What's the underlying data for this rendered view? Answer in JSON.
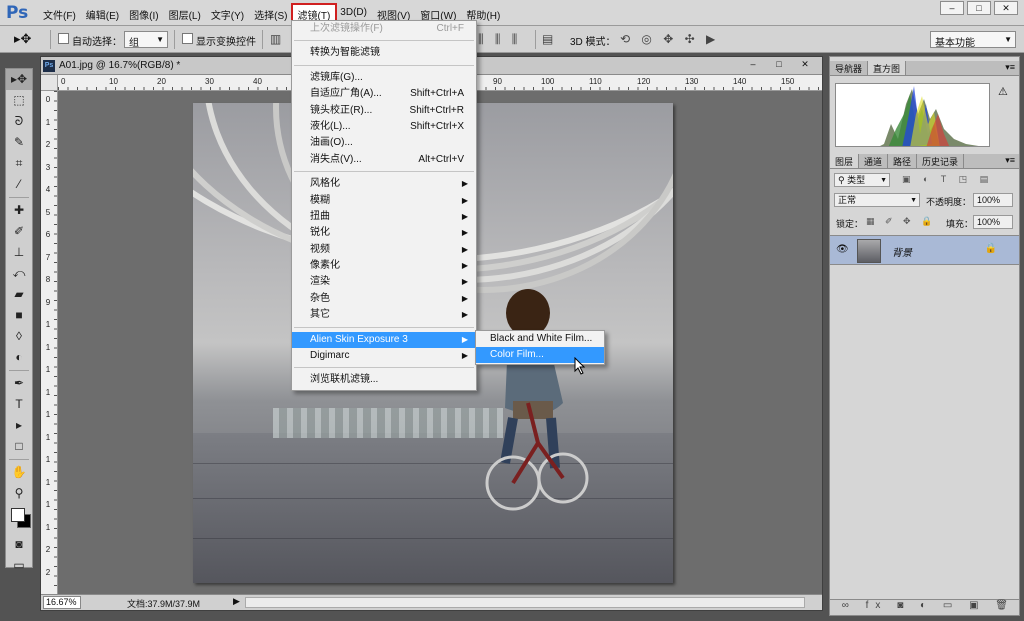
{
  "app": {
    "logo": "Ps"
  },
  "menubar": {
    "items": [
      "文件(F)",
      "编辑(E)",
      "图像(I)",
      "图层(L)",
      "文字(Y)",
      "选择(S)",
      "滤镜(T)",
      "3D(D)",
      "视图(V)",
      "窗口(W)",
      "帮助(H)"
    ],
    "active_index": 6
  },
  "window_controls": {
    "minimize": "–",
    "maximize": "□",
    "close": "✕"
  },
  "options": {
    "auto_select_label": "自动选择：",
    "auto_select_value": "组",
    "show_transform_label": "显示变换控件",
    "mode3d_label": "3D 模式：",
    "workspace": "基本功能"
  },
  "document": {
    "title": "A01.jpg @ 16.7%(RGB/8) *",
    "ruler_h": [
      "0",
      "10",
      "20",
      "30",
      "40",
      "50",
      "60",
      "70",
      "80",
      "90",
      "100",
      "110",
      "120",
      "130",
      "140",
      "150"
    ],
    "ruler_v": [
      "0",
      "1",
      "2",
      "3",
      "4",
      "5",
      "6",
      "7",
      "8",
      "9",
      "1",
      "1",
      "1",
      "1",
      "1",
      "1",
      "1",
      "1",
      "1",
      "1",
      "2",
      "2"
    ],
    "zoom": "16.67%",
    "status": "文档:37.9M/37.9M",
    "btn_min": "–",
    "btn_max": "□",
    "btn_close": "✕"
  },
  "filter_menu": {
    "last_filter": {
      "label": "上次滤镜操作(F)",
      "shortcut": "Ctrl+F"
    },
    "smart": "转换为智能滤镜",
    "group2": [
      {
        "label": "滤镜库(G)...",
        "shortcut": ""
      },
      {
        "label": "自适应广角(A)...",
        "shortcut": "Shift+Ctrl+A"
      },
      {
        "label": "镜头校正(R)...",
        "shortcut": "Shift+Ctrl+R"
      },
      {
        "label": "液化(L)...",
        "shortcut": "Shift+Ctrl+X"
      },
      {
        "label": "油画(O)...",
        "shortcut": ""
      },
      {
        "label": "消失点(V)...",
        "shortcut": "Alt+Ctrl+V"
      }
    ],
    "group3": [
      "风格化",
      "模糊",
      "扭曲",
      "锐化",
      "视频",
      "像素化",
      "渲染",
      "杂色",
      "其它"
    ],
    "plugins": [
      "Alien Skin Exposure 3",
      "Digimarc"
    ],
    "browse": "浏览联机滤镜..."
  },
  "submenu": {
    "items": [
      "Black and White Film...",
      "Color Film..."
    ],
    "highlight_index": 1
  },
  "panels": {
    "top_tabs": [
      "导航器",
      "直方图"
    ],
    "layers_tabs": [
      "图层",
      "通道",
      "路径",
      "历史记录"
    ],
    "kind": "类型",
    "blend_mode": "正常",
    "opacity_label": "不透明度：",
    "opacity": "100%",
    "lock_label": "锁定：",
    "fill_label": "填充：",
    "fill": "100%",
    "layer_name": "背景"
  }
}
